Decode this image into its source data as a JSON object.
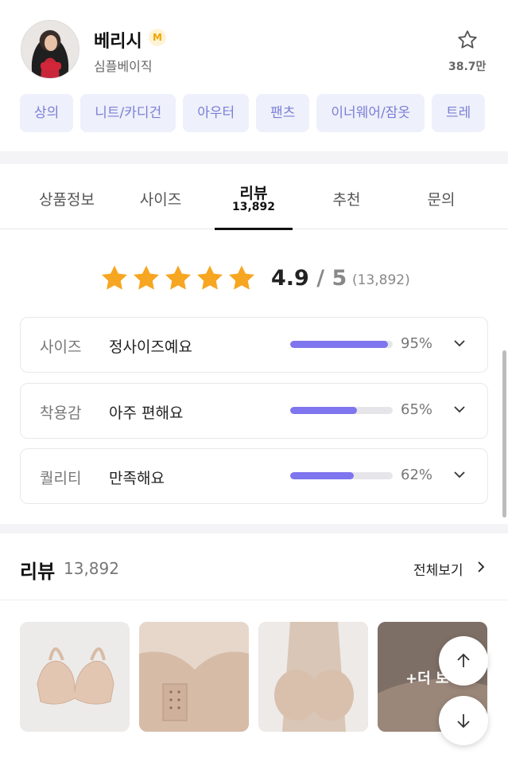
{
  "brand": {
    "name": "베리시",
    "badge": "M",
    "subtitle": "심플베이직",
    "favorite_count": "38.7만"
  },
  "categories": [
    "상의",
    "니트/카디건",
    "아우터",
    "팬츠",
    "이너웨어/잠옷",
    "트레"
  ],
  "tabs": [
    {
      "label": "상품정보"
    },
    {
      "label": "사이즈"
    },
    {
      "label": "리뷰",
      "sub": "13,892"
    },
    {
      "label": "추천"
    },
    {
      "label": "문의"
    }
  ],
  "rating": {
    "score": "4.9",
    "slash": "/",
    "max": "5",
    "count": "(13,892)",
    "stars": 5
  },
  "evaluations": [
    {
      "key": "사이즈",
      "value": "정사이즈예요",
      "percent": "95%",
      "fill": 0.95
    },
    {
      "key": "착용감",
      "value": "아주 편해요",
      "percent": "65%",
      "fill": 0.65
    },
    {
      "key": "퀄리티",
      "value": "만족해요",
      "percent": "62%",
      "fill": 0.62
    }
  ],
  "reviews": {
    "title": "리뷰",
    "count": "13,892",
    "view_all": "전체보기",
    "more_label": "+더 보"
  },
  "colors": {
    "accent": "#7f75ee",
    "chip_bg": "#eef0fb",
    "chip_text": "#7c7fd6",
    "star": "#f7a622"
  }
}
